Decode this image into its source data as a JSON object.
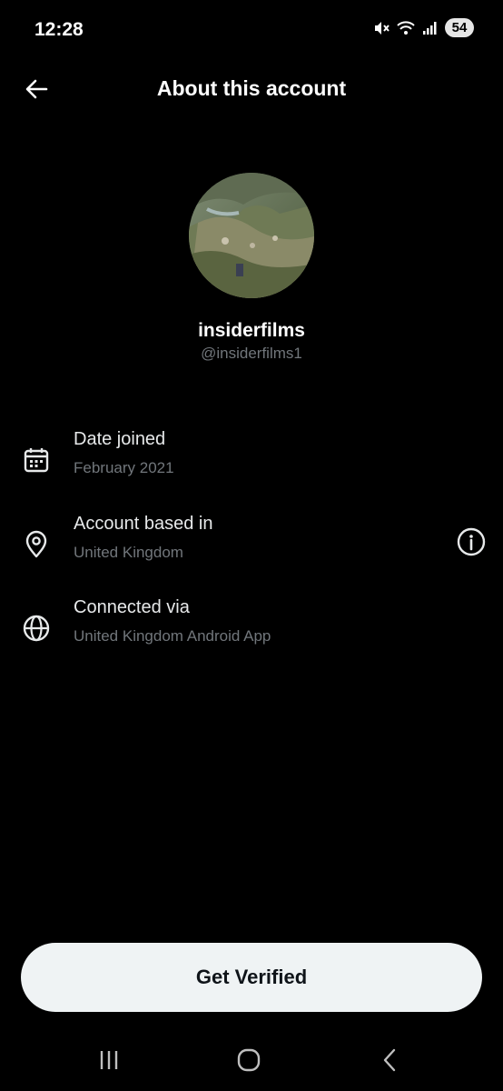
{
  "status_bar": {
    "time": "12:28",
    "battery": "54",
    "icons": [
      "mute-icon",
      "wifi-icon",
      "signal-icon",
      "battery-icon"
    ]
  },
  "header": {
    "title": "About this account",
    "back_icon": "arrow-left-icon"
  },
  "profile": {
    "display_name": "insiderfilms",
    "handle": "@insiderfilms1"
  },
  "details": [
    {
      "icon": "calendar-icon",
      "label": "Date joined",
      "value": "February 2021"
    },
    {
      "icon": "location-pin-icon",
      "label": "Account based in",
      "value": "United Kingdom",
      "action_icon": "info-icon"
    },
    {
      "icon": "globe-icon",
      "label": "Connected via",
      "value": "United Kingdom Android App"
    }
  ],
  "cta": {
    "label": "Get Verified"
  },
  "system_nav": {
    "items": [
      "recents-icon",
      "home-icon",
      "back-icon"
    ]
  },
  "colors": {
    "background": "#000000",
    "primary_text": "#e7e9ea",
    "secondary_text": "#71767b",
    "button_bg": "#eff3f4",
    "button_text": "#0f1419"
  }
}
